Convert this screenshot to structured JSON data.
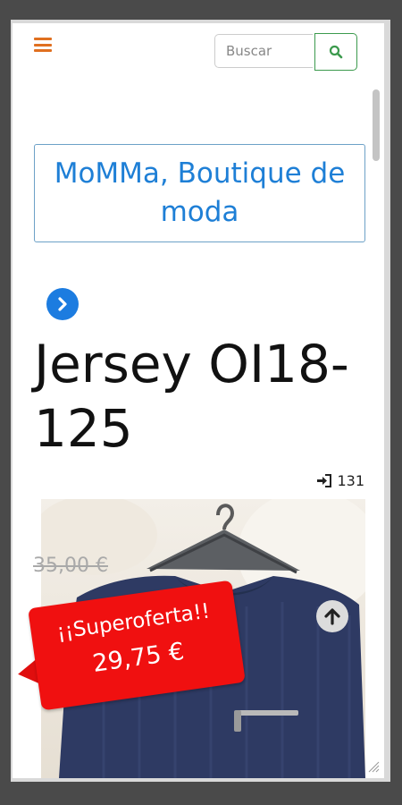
{
  "header": {
    "menu_icon": "hamburger-menu-icon",
    "search": {
      "placeholder": "Buscar",
      "icon": "search-icon"
    }
  },
  "brand": {
    "name": "MoMMa, Boutique de moda"
  },
  "navigation": {
    "next_icon": "chevron-right-circle-icon"
  },
  "product": {
    "title": "Jersey OI18-125",
    "visits_icon": "sign-in-icon",
    "visits_count": "131",
    "old_price": "35,00 €",
    "offer_label": "¡¡Superoferta!!",
    "offer_price": "29,75 €",
    "image_icon": "sweater-photo"
  },
  "scroll_top_icon": "arrow-up-circle-icon",
  "colors": {
    "accent_orange": "#e07020",
    "brand_blue": "#1e7fd6",
    "search_green": "#3c9a4d",
    "offer_red": "#f01010"
  }
}
